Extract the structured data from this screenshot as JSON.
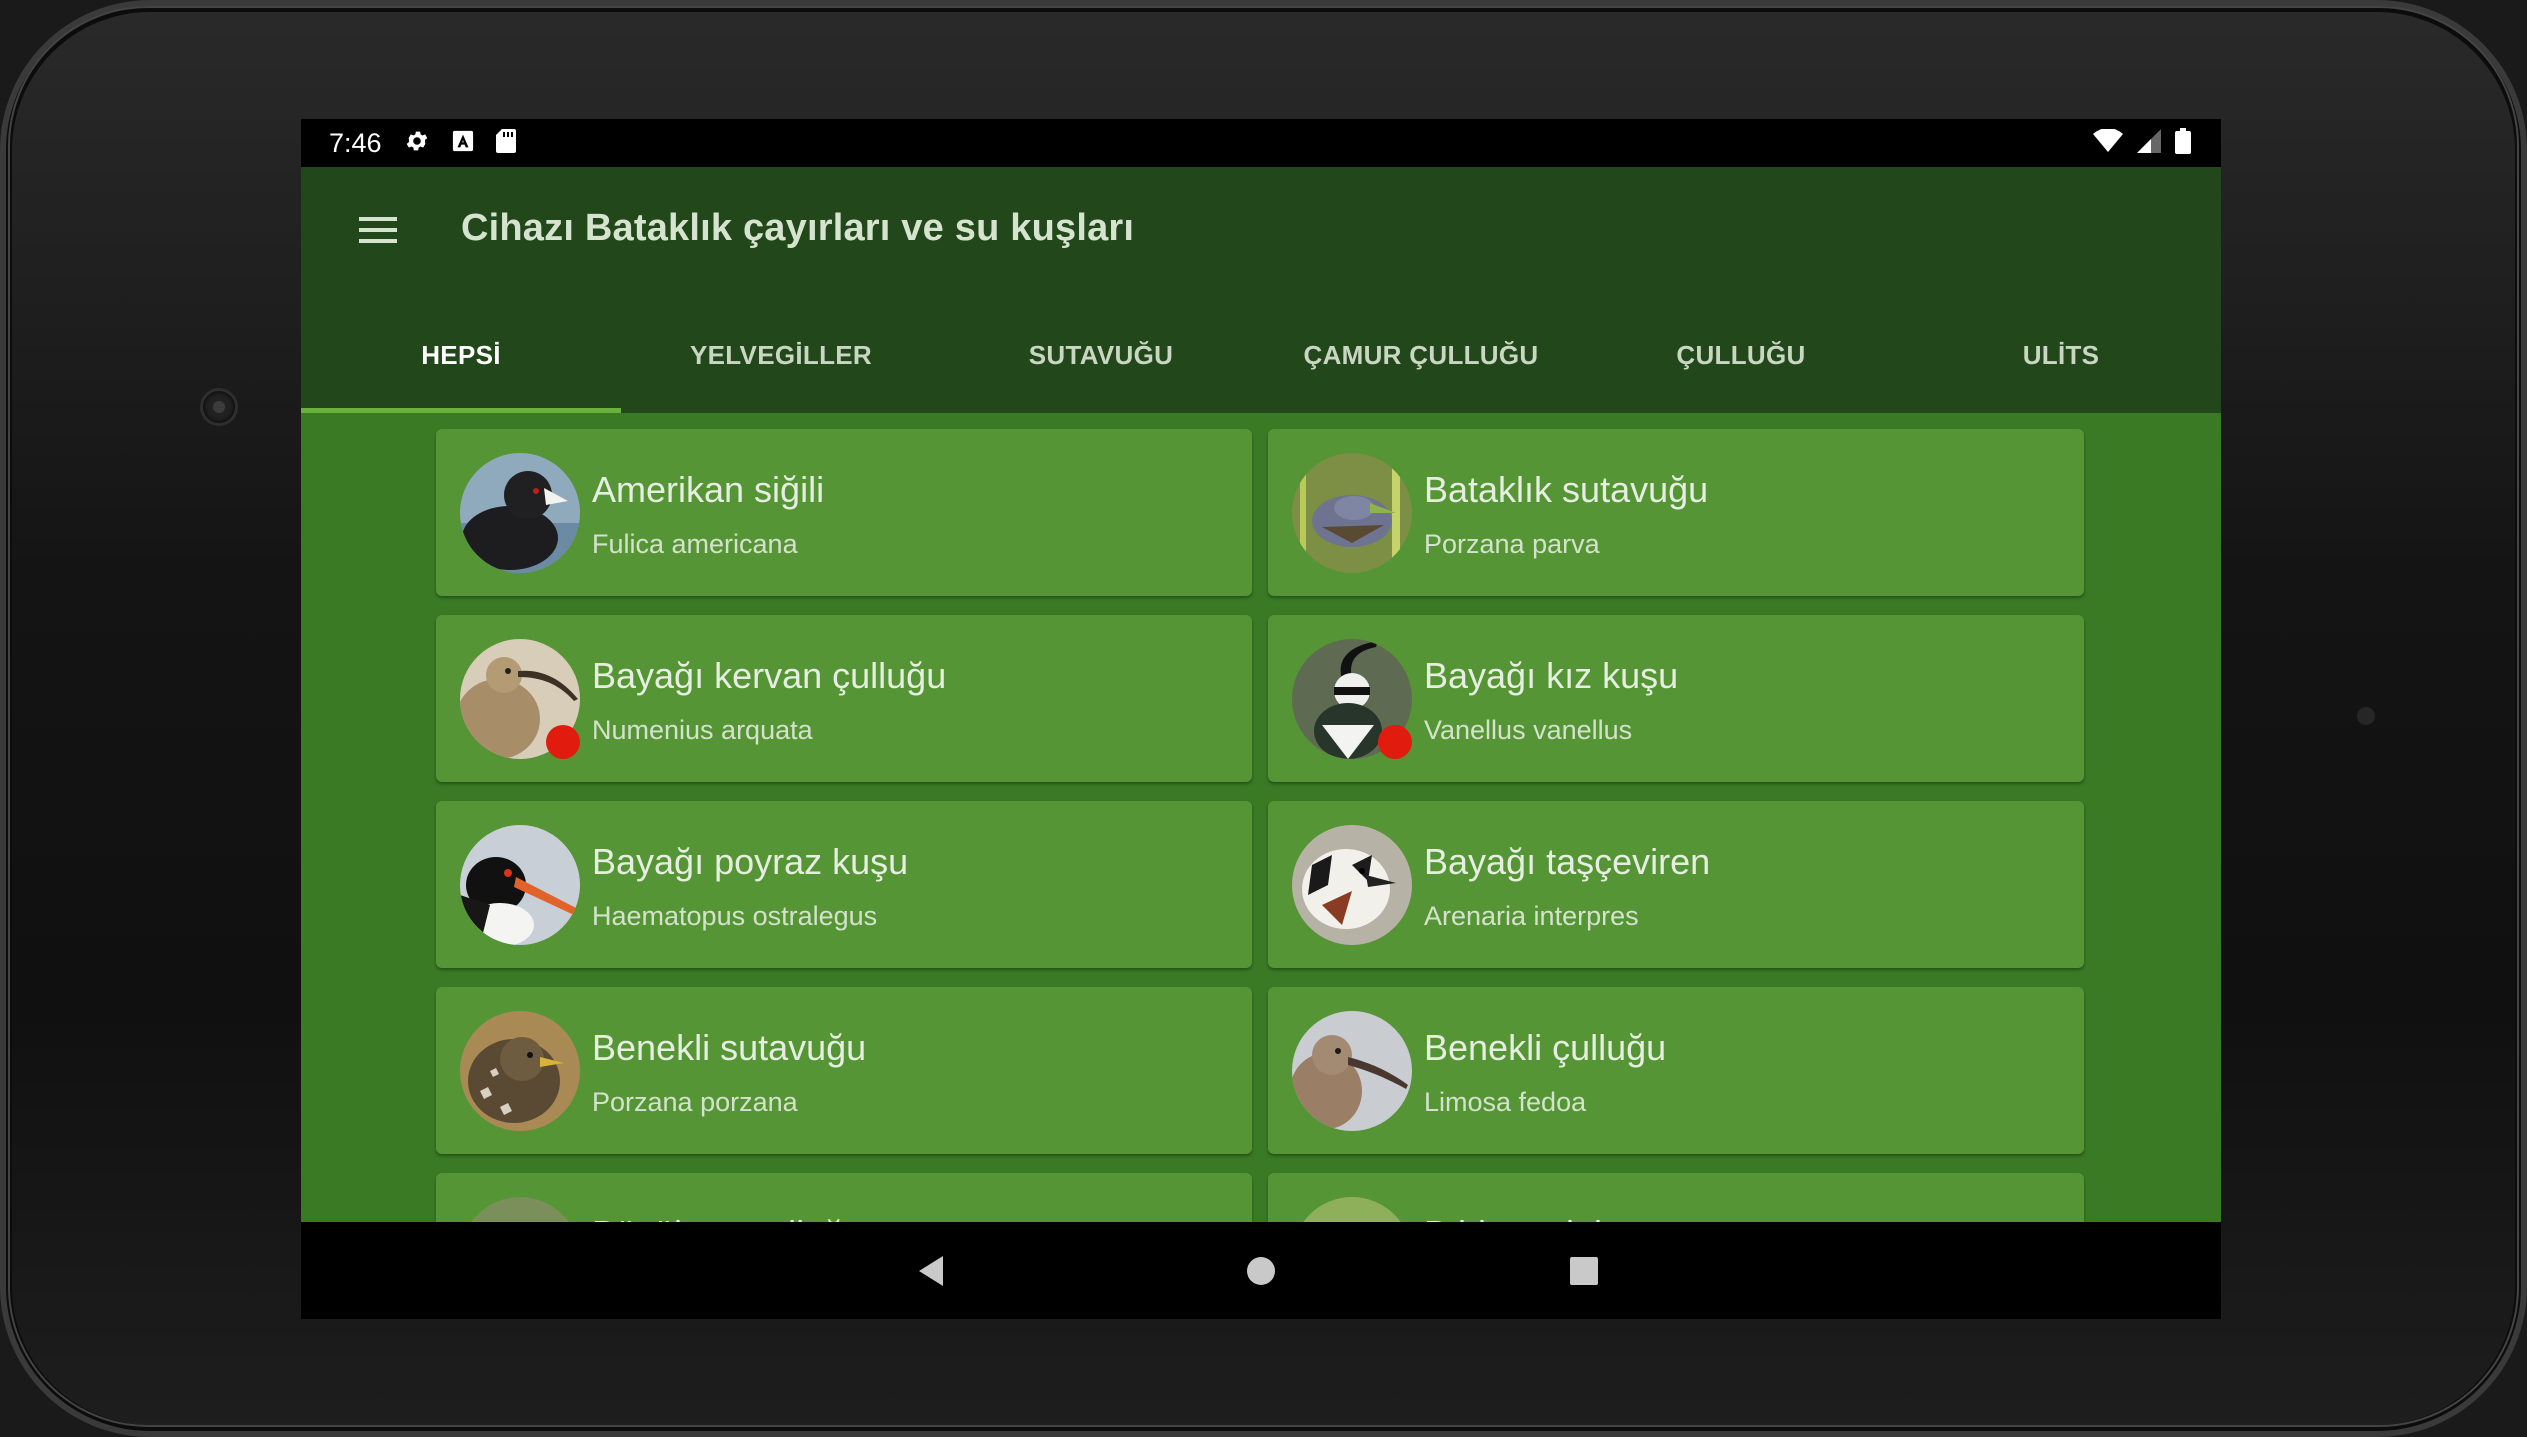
{
  "status_bar": {
    "time": "7:46",
    "left_icons": [
      "gear-icon",
      "a-box-icon",
      "sd-card-icon"
    ],
    "right_icons": [
      "wifi-icon",
      "signal-icon",
      "battery-icon"
    ]
  },
  "app_bar": {
    "title": "Cihazı Bataklık çayırları ve su kuşları"
  },
  "tabs": [
    {
      "label": "HEPSİ",
      "active": true
    },
    {
      "label": "YELVEGİLLER",
      "active": false
    },
    {
      "label": "SUTAVUĞU",
      "active": false
    },
    {
      "label": "ÇAMUR ÇULLUĞU",
      "active": false
    },
    {
      "label": "ÇULLUĞU",
      "active": false
    },
    {
      "label": "ULİTS",
      "active": false
    }
  ],
  "birds": [
    {
      "name": "Amerikan siğili",
      "latin": "Fulica americana",
      "recording": false
    },
    {
      "name": "Bataklık sutavuğu",
      "latin": "Porzana parva",
      "recording": false
    },
    {
      "name": "Bayağı kervan çulluğu",
      "latin": "Numenius arquata",
      "recording": true
    },
    {
      "name": "Bayağı kız kuşu",
      "latin": "Vanellus vanellus",
      "recording": true
    },
    {
      "name": "Bayağı poyraz kuşu",
      "latin": "Haematopus ostralegus",
      "recording": false
    },
    {
      "name": "Bayağı taşçeviren",
      "latin": "Arenaria interpres",
      "recording": false
    },
    {
      "name": "Benekli sutavuğu",
      "latin": "Porzana porzana",
      "recording": false
    },
    {
      "name": "Benekli çulluğu",
      "latin": "Limosa fedoa",
      "recording": false
    },
    {
      "name": "Büyük su çulluğu",
      "latin": "",
      "recording": false
    },
    {
      "name": "Bıldırcın kılavuzu",
      "latin": "",
      "recording": false
    }
  ],
  "colors": {
    "app_bar": "#22471a",
    "background": "#3a7a25",
    "card": "#559535",
    "tab_indicator": "#6ab03d",
    "recording_dot": "#e21b0f"
  },
  "nav_icons": [
    "back-icon",
    "home-icon",
    "recents-icon"
  ]
}
